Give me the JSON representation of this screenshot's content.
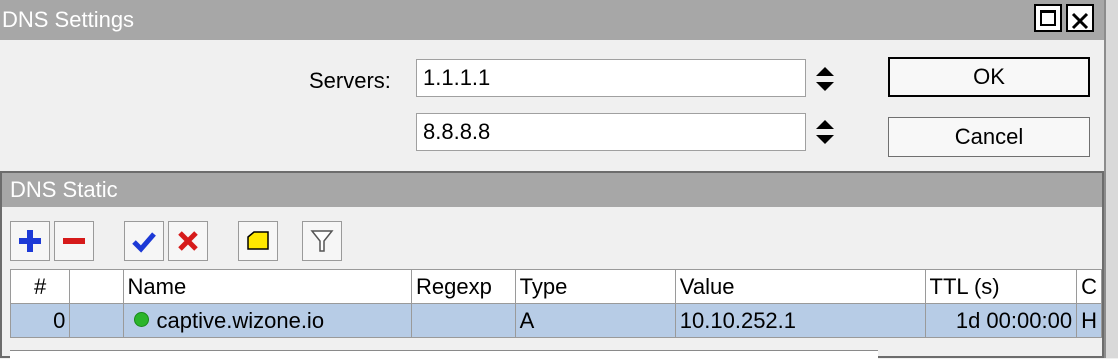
{
  "dns_settings": {
    "title": "DNS Settings",
    "servers_label": "Servers:",
    "servers": [
      "1.1.1.1",
      "8.8.8.8"
    ],
    "ok_label": "OK",
    "cancel_label": "Cancel"
  },
  "dns_static": {
    "title": "DNS Static",
    "toolbar": [
      "add-icon",
      "remove-icon",
      "enable-icon",
      "disable-icon",
      "comment-icon",
      "filter-icon"
    ],
    "columns": [
      "#",
      "",
      "Name",
      "Regexp",
      "Type",
      "Value",
      "TTL (s)",
      "C"
    ],
    "rows": [
      {
        "num": "0",
        "flag": "",
        "name": "captive.wizone.io",
        "regexp": "",
        "type": "A",
        "value": "10.10.252.1",
        "ttl": "1d 00:00:00",
        "extra": "H"
      }
    ]
  },
  "colors": {
    "titlebar": "#a7a7a7",
    "selected_row": "#b7cce6",
    "add_icon": "#1c39d6",
    "remove_icon": "#d61a1a",
    "status_dot": "#2bb52b"
  }
}
